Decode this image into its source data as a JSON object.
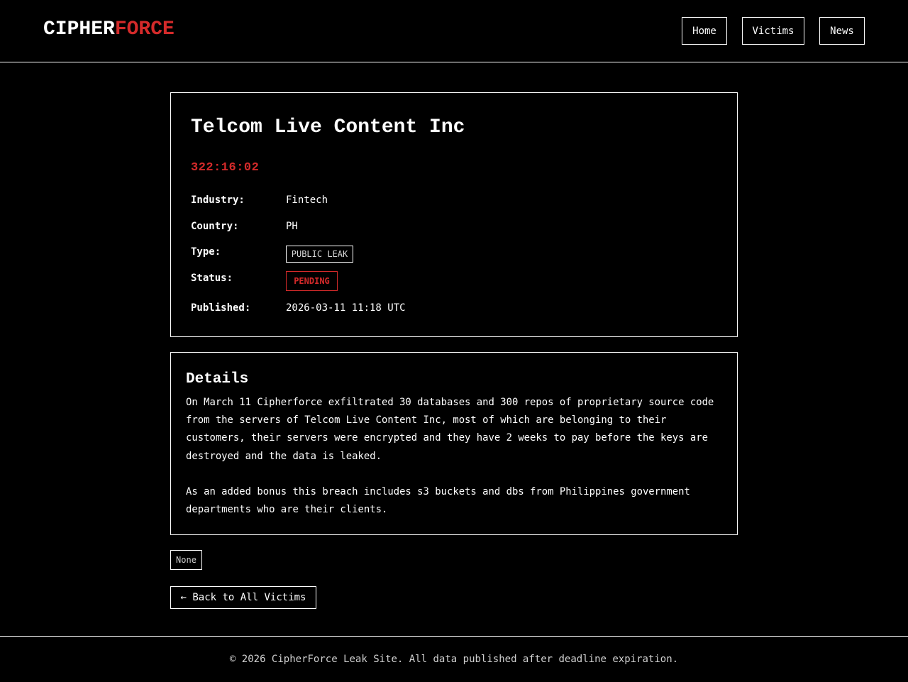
{
  "header": {
    "logo_part1": "CIPHER",
    "logo_part2": "FORCE",
    "nav": {
      "home": "Home",
      "victims": "Victims",
      "news": "News"
    }
  },
  "victim": {
    "name": "Telcom Live Content Inc",
    "countdown": "322:16:02",
    "fields": {
      "industry_label": "Industry:",
      "industry_value": "Fintech",
      "country_label": "Country:",
      "country_value": "PH",
      "type_label": "Type:",
      "type_value": "PUBLIC LEAK",
      "status_label": "Status:",
      "status_value": "PENDING",
      "published_label": "Published:",
      "published_value": "2026-03-11 11:18 UTC"
    }
  },
  "details": {
    "title": "Details",
    "paragraph1": "On March 11 Cipherforce exfiltrated 30 databases and 300 repos of proprietary source code from the servers of Telcom Live Content Inc, most of which are belonging to their customers, their servers were encrypted and they have 2 weeks to pay before the keys are destroyed and the data is leaked.",
    "paragraph2": "As an added bonus this breach includes s3 buckets and dbs from Philippines government departments who are their clients."
  },
  "attachments_tag": "None",
  "back_button": "← Back to All Victims",
  "footer": "© 2026 CipherForce Leak Site. All data published after deadline expiration.",
  "colors": {
    "accent": "#d42a2a",
    "background": "#000000",
    "foreground": "#ffffff"
  }
}
